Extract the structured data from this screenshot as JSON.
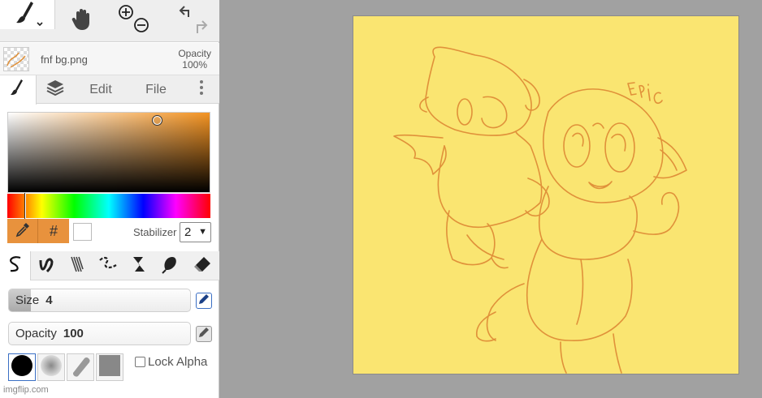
{
  "toolbar": {
    "tools": [
      {
        "name": "brush",
        "icon": "brush-icon",
        "active": true
      },
      {
        "name": "hand",
        "icon": "hand-icon"
      },
      {
        "name": "zoom",
        "icon": "zoom-icon"
      },
      {
        "name": "undo-redo",
        "icon": "undo-icon"
      }
    ]
  },
  "file": {
    "name": "fnf bg.png",
    "opacity_label": "Opacity",
    "opacity_value": "100%"
  },
  "tabs": {
    "edit": "Edit",
    "file": "File"
  },
  "color": {
    "current": "#f39322",
    "hex_symbol": "#",
    "secondary": "#ffffff"
  },
  "stabilizer": {
    "label": "Stabilizer",
    "value": "2"
  },
  "brushes": [
    "pen-brush",
    "ink-brush",
    "bristle-brush",
    "dash-brush",
    "calligraphy-brush",
    "fill-brush",
    "eraser"
  ],
  "size": {
    "label": "Size",
    "value": "4",
    "level": 0.12
  },
  "opacity": {
    "label": "Opacity",
    "value": "100"
  },
  "tips": [
    "hard-round-tip",
    "soft-tip",
    "pill-tip",
    "square-tip"
  ],
  "lock_alpha": {
    "label": "Lock Alpha",
    "checked": false
  },
  "watermark": "imgflip.com",
  "canvas": {
    "background": "#fae571",
    "stroke": "#e0913a"
  }
}
